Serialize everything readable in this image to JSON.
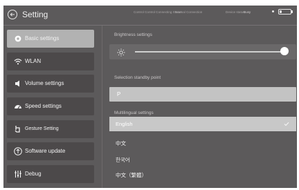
{
  "header": {
    "title": "Setting",
    "status_1": "Control Control Connecting Status",
    "status_2": "Normal Connection",
    "status_3": "Device status",
    "status_4": "Busy",
    "battery_level": 0.2
  },
  "sidebar": {
    "items": [
      {
        "label": "Basic settings",
        "icon": "gear-icon",
        "active": true
      },
      {
        "label": "WLAN",
        "icon": "wifi-icon",
        "active": false
      },
      {
        "label": "Volume settings",
        "icon": "speaker-icon",
        "active": false
      },
      {
        "label": "Speed settings",
        "icon": "speedometer-icon",
        "active": false
      },
      {
        "label": "Gesture Setting",
        "icon": "hand-pointer-icon",
        "active": false
      },
      {
        "label": "Software update",
        "icon": "upload-icon",
        "active": false
      },
      {
        "label": "Debug",
        "icon": "sliders-icon",
        "active": false
      }
    ]
  },
  "main": {
    "brightness": {
      "label": "Brightness settings",
      "value": 0.95
    },
    "standby": {
      "label": "Selection standby point",
      "value": "P"
    },
    "language": {
      "label": "Multilingual settings",
      "options": [
        "English",
        "中文",
        "한국어",
        "中文（繁體）"
      ],
      "selected": "English"
    }
  },
  "colors": {
    "background": "#5c5a5b",
    "sidebar_item": "#4c494a",
    "sidebar_active": "#b2b2b2",
    "field_light": "#c3c3c3",
    "text": "#f2f2f2"
  }
}
